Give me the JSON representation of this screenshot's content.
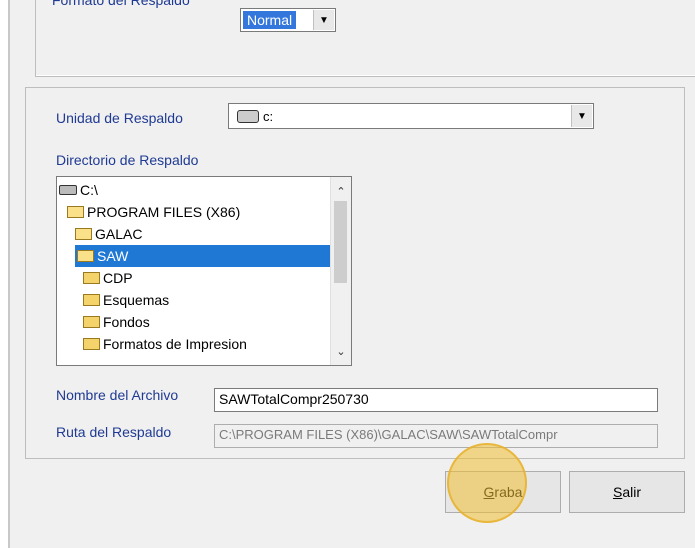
{
  "formato": {
    "label": "Formato del Respaldo",
    "value": "Normal"
  },
  "unidad": {
    "label": "Unidad de Respaldo",
    "value": "c:"
  },
  "directorio": {
    "label": "Directorio de Respaldo",
    "items": [
      {
        "label": "C:\\",
        "icon": "drive-icon"
      },
      {
        "label": "PROGRAM FILES (X86)",
        "icon": "open-folder-icon"
      },
      {
        "label": "GALAC",
        "icon": "open-folder-icon"
      },
      {
        "label": "SAW",
        "icon": "open-folder-icon",
        "selected": true
      },
      {
        "label": "CDP",
        "icon": "folder-icon"
      },
      {
        "label": "Esquemas",
        "icon": "folder-icon"
      },
      {
        "label": "Fondos",
        "icon": "folder-icon"
      },
      {
        "label": "Formatos de Impresion",
        "icon": "folder-icon"
      }
    ]
  },
  "nombre": {
    "label": "Nombre del Archivo",
    "value": "SAWTotalCompr250730"
  },
  "ruta": {
    "label": "Ruta del Respaldo",
    "value": "C:\\PROGRAM FILES (X86)\\GALAC\\SAW\\SAWTotalCompr"
  },
  "buttons": {
    "grabar_first": "G",
    "grabar_rest": "raba",
    "salir_first": "S",
    "salir_rest": "alir"
  },
  "colors": {
    "label_text": "#1f3a93",
    "selection": "#1e78d4",
    "highlight": "#f0be32"
  }
}
